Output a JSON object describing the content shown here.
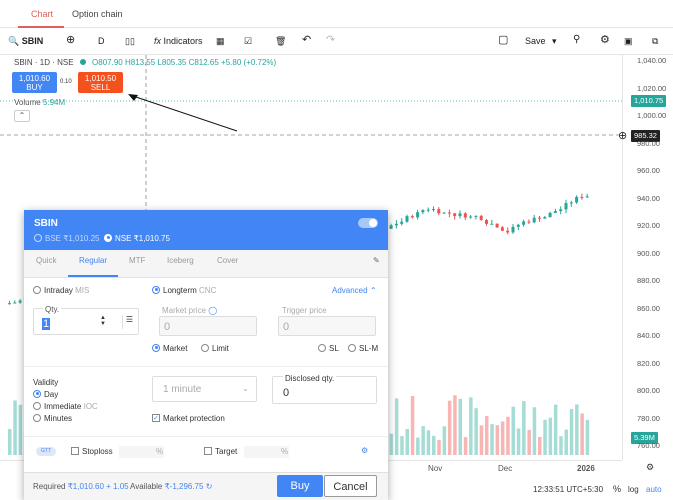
{
  "tabs": {
    "chart": "Chart",
    "option_chain": "Option chain"
  },
  "toolbar": {
    "symbol": "SBIN",
    "interval": "D",
    "indicators": "Indicators",
    "save": "Save"
  },
  "legend": {
    "title": "SBIN · 1D · NSE",
    "ohlc": "O807.90 H813.55 L805.35 C812.65 +5.80 (+0.72%)"
  },
  "quick_trade": {
    "buy_price": "1,010.60",
    "buy_label": "BUY",
    "sell_price": "1,010.50",
    "sell_label": "SELL",
    "spread": "0.10"
  },
  "volume": {
    "label": "Volume",
    "value": "5.94M"
  },
  "y_axis": {
    "ticks": [
      "1,040.00",
      "1,020.00",
      "1,000.00",
      "980.00",
      "960.00",
      "940.00",
      "920.00",
      "900.00",
      "880.00",
      "860.00",
      "840.00",
      "820.00",
      "800.00",
      "780.00",
      "760.00"
    ],
    "last_price": "1,010.75",
    "crosshair_price": "985.32",
    "volume_tag": "5.39M"
  },
  "x_axis": {
    "ticks": [
      "Nov",
      "Dec",
      "2026"
    ]
  },
  "status": {
    "time": "12:33:51 UTC+5:30",
    "percent": "%",
    "log": "log",
    "auto": "auto"
  },
  "order": {
    "symbol": "SBIN",
    "bse": "BSE ₹1,010.25",
    "nse": "NSE ₹1,010.75",
    "tabs": [
      "Quick",
      "Regular",
      "MTF",
      "Iceberg",
      "Cover"
    ],
    "intraday": "Intraday",
    "mis": "MIS",
    "longterm": "Longterm",
    "cnc": "CNC",
    "advanced": "Advanced",
    "qty_label": "Qty.",
    "qty_value": "1",
    "market_price_label": "Market price",
    "market_price_value": "0",
    "trigger_price_label": "Trigger price",
    "trigger_price_value": "0",
    "market": "Market",
    "limit": "Limit",
    "sl": "SL",
    "slm": "SL-M",
    "validity_label": "Validity",
    "day": "Day",
    "immediate": "Immediate",
    "ioc": "IOC",
    "minutes": "Minutes",
    "minutes_select": "1 minute",
    "disclosed_label": "Disclosed qty.",
    "disclosed_value": "0",
    "market_protection": "Market protection",
    "gtt": "GTT",
    "stoploss": "Stoploss",
    "target": "Target",
    "pct": "%",
    "required_label": "Required",
    "required_value": "₹1,010.60 + 1.05",
    "available_label": "Available",
    "available_value": "₹-1,296.75",
    "buy": "Buy",
    "cancel": "Cancel"
  },
  "colors": {
    "up": "#26a69a",
    "down": "#ef5350",
    "blue": "#4285f4",
    "sell": "#f4511e"
  }
}
